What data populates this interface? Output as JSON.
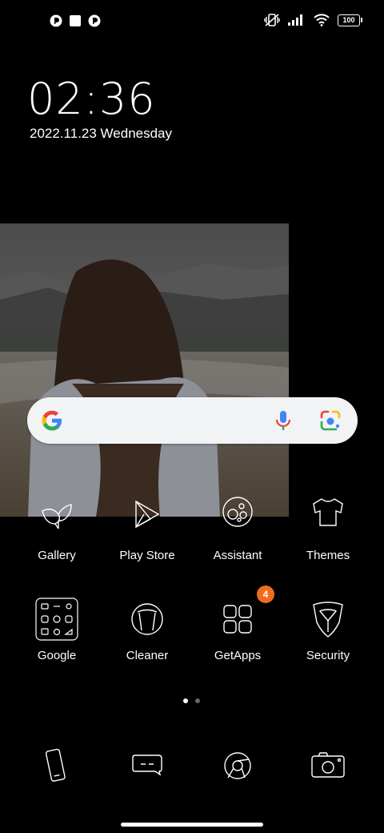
{
  "status_bar": {
    "battery": "100",
    "notifications": [
      "app-notification-icon",
      "square-notification-icon",
      "app-notification-icon"
    ]
  },
  "clock": {
    "time": "02:36",
    "date": "2022.11.23 Wednesday"
  },
  "apps_row1": [
    {
      "label": "Gallery",
      "icon": "leaf-icon"
    },
    {
      "label": "Play Store",
      "icon": "play-store-icon"
    },
    {
      "label": "Assistant",
      "icon": "assistant-icon"
    },
    {
      "label": "Themes",
      "icon": "tshirt-icon"
    }
  ],
  "apps_row2": [
    {
      "label": "Google",
      "icon": "google-folder-icon"
    },
    {
      "label": "Cleaner",
      "icon": "trash-icon"
    },
    {
      "label": "GetApps",
      "icon": "grid-icon",
      "badge": "4"
    },
    {
      "label": "Security",
      "icon": "shield-icon"
    }
  ],
  "pages": {
    "count": 2,
    "current": 1
  },
  "dock": [
    "phone-icon",
    "messages-icon",
    "chrome-icon",
    "camera-icon"
  ]
}
